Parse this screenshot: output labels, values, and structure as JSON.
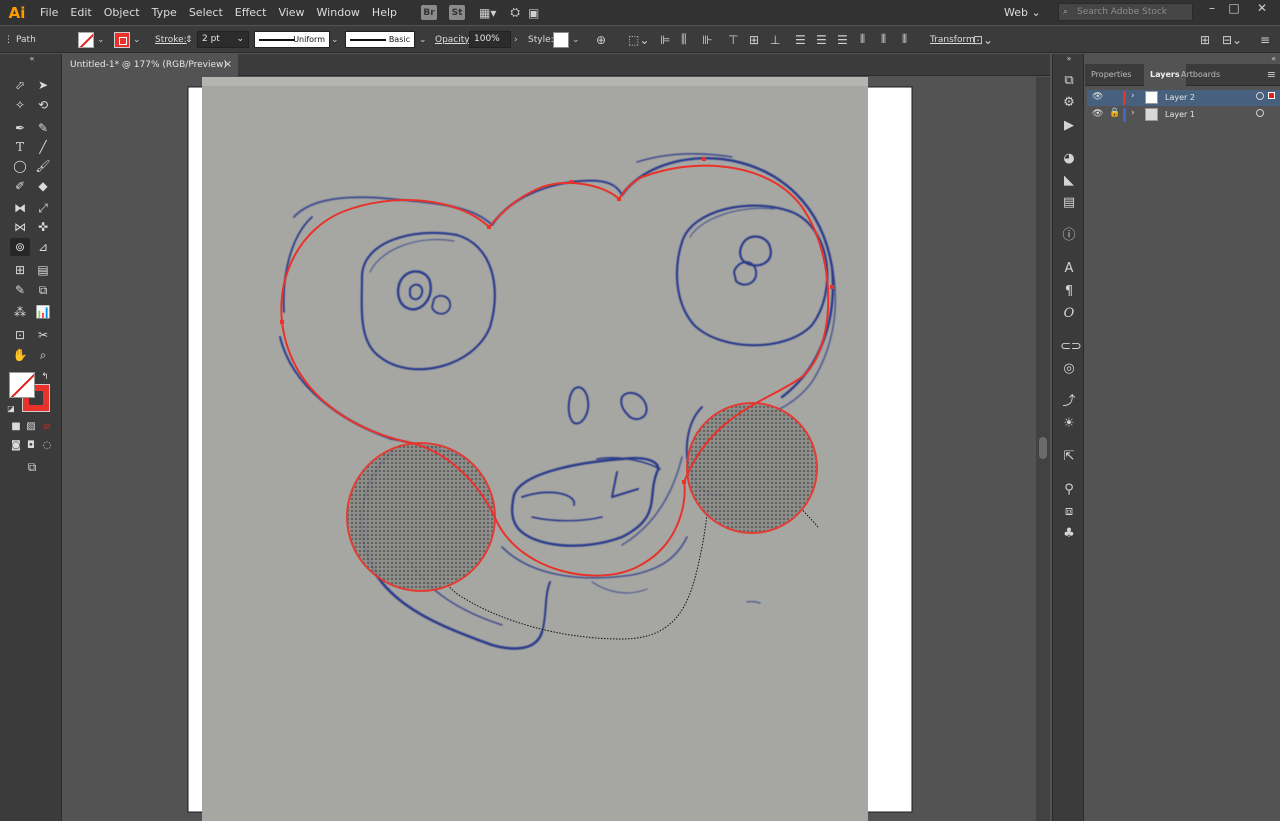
{
  "app": {
    "logo": "Ai"
  },
  "menu": [
    "File",
    "Edit",
    "Object",
    "Type",
    "Select",
    "Effect",
    "View",
    "Window",
    "Help"
  ],
  "menu_badges": [
    "Br",
    "St"
  ],
  "workspace": "Web",
  "stock_search": {
    "placeholder": "Search Adobe Stock"
  },
  "control": {
    "selection_type": "Path",
    "stroke_label": "Stroke:",
    "stroke_weight": "2 pt",
    "stroke_profile": "Uniform",
    "brush": "Basic",
    "opacity_label": "Opacity:",
    "opacity_value": "100%",
    "style_label": "Style:",
    "transform_label": "Transform"
  },
  "document": {
    "tab_title": "Untitled-1* @ 177% (RGB/Preview)",
    "close_glyph": "×"
  },
  "panels": {
    "tabs": [
      "Properties",
      "Layers",
      "Artboards"
    ],
    "active_tab": "Layers",
    "layers": [
      {
        "name": "Layer 2",
        "color": "#e8322a",
        "selected": true,
        "locked": false
      },
      {
        "name": "Layer 1",
        "color": "#3d68c9",
        "selected": false,
        "locked": true
      }
    ]
  },
  "colors": {
    "stroke_red": "#e8322a",
    "sketch_blue": "#2c3a8c",
    "paper": "#a6a7a2",
    "selection_blue": "#46607e"
  }
}
